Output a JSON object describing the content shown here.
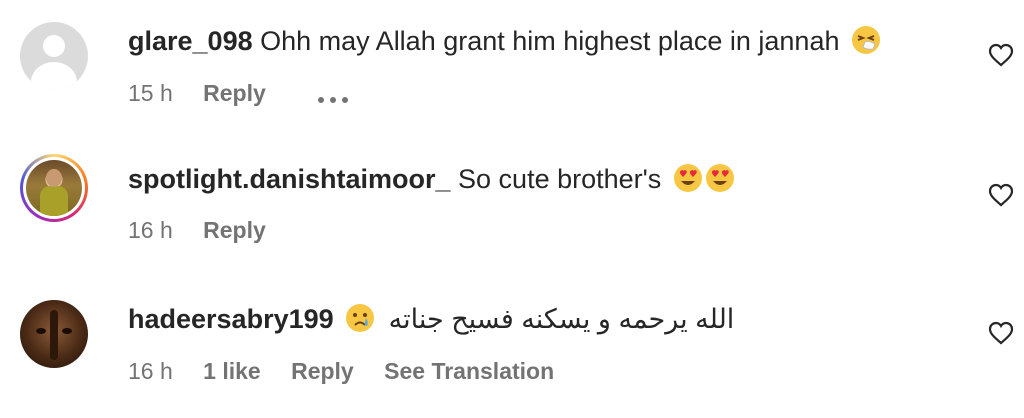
{
  "comments": [
    {
      "username": "glare_098",
      "text": "Ohh may Allah grant him highest place in jannah",
      "emojis": [
        "sneezing-face-emoji"
      ],
      "time": "15 h",
      "likes": "",
      "reply": "Reply",
      "translate": "",
      "avatar": "default-avatar-icon"
    },
    {
      "username": "spotlight.danishtaimoor_",
      "text": "So cute brother's",
      "emojis": [
        "heart-eyes-emoji",
        "heart-eyes-emoji"
      ],
      "time": "16 h",
      "likes": "",
      "reply": "Reply",
      "translate": "",
      "avatar": "story-ring-avatar"
    },
    {
      "username": "hadeersabry199",
      "text": "الله يرحمه و يسكنه فسيح جناته",
      "emojis": [
        "crying-face-emoji"
      ],
      "time": "16 h",
      "likes": "1 like",
      "reply": "Reply",
      "translate": "See Translation",
      "avatar": "photo-avatar"
    }
  ],
  "colors": {
    "primary_text": "#262626",
    "secondary_text": "#737373",
    "background": "#ffffff"
  },
  "icons": {
    "like": "heart-outline-icon",
    "more": "more-options-icon"
  }
}
